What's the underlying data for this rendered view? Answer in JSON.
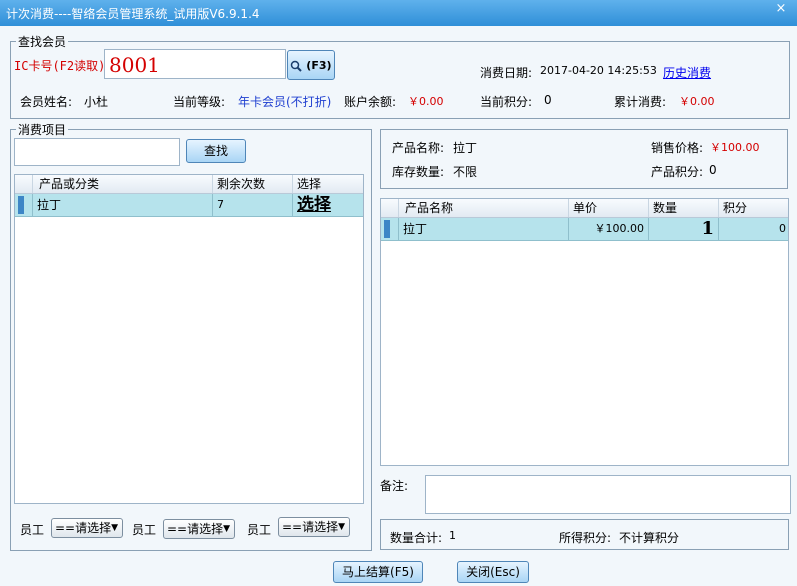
{
  "window": {
    "title": "计次消费----智络会员管理系统_试用版V6.9.1.4",
    "close_label": "×"
  },
  "find_member": {
    "legend": "查找会员",
    "ic_label": "IC卡号(F2读取)",
    "ic_value": "8001",
    "search_button": "(F3)",
    "date_label": "消费日期:",
    "date_value": "2017-04-20 14:25:53",
    "history_link": "历史消费",
    "name_label": "会员姓名:",
    "name_value": "小杜",
    "level_label": "当前等级:",
    "level_value": "年卡会员(不打折)",
    "balance_label": "账户余额:",
    "balance_value": "￥0.00",
    "points_label": "当前积分:",
    "points_value": "0",
    "total_label": "累计消费:",
    "total_value": "￥0.00"
  },
  "items": {
    "legend": "消费项目",
    "search_placeholder": "",
    "search_button": "查找",
    "columns": [
      "产品或分类",
      "剩余次数",
      "选择"
    ],
    "rows": [
      {
        "name": "拉丁",
        "remaining": "7",
        "action": "选择"
      }
    ]
  },
  "staff": {
    "labels": [
      "员工",
      "员工",
      "员工"
    ],
    "selects": [
      "==请选择",
      "==请选择",
      "==请选择"
    ]
  },
  "product_info": {
    "name_label": "产品名称:",
    "name_value": "拉丁",
    "price_label": "销售价格:",
    "price_value": "￥100.00",
    "stock_label": "库存数量:",
    "stock_value": "不限",
    "points_label": "产品积分:",
    "points_value": "0"
  },
  "cart": {
    "columns": [
      "产品名称",
      "单价",
      "数量",
      "积分"
    ],
    "rows": [
      {
        "name": "拉丁",
        "price": "￥100.00",
        "qty": "1",
        "points": "0"
      }
    ]
  },
  "remark": {
    "label": "备注:",
    "value": ""
  },
  "summary": {
    "qty_label": "数量合计:",
    "qty_value": "1",
    "points_label": "所得积分:",
    "points_value": "不计算积分"
  },
  "footer": {
    "checkout": "马上结算(F5)",
    "close": "关闭(Esc)"
  },
  "colors": {
    "title_bar": "#2f8fd8",
    "selected_row": "#b6e3ec",
    "money_red": "#d40000"
  },
  "icons": {
    "search": "magnifier-icon",
    "close": "close-icon",
    "dropdown": "chevron-down-icon"
  }
}
